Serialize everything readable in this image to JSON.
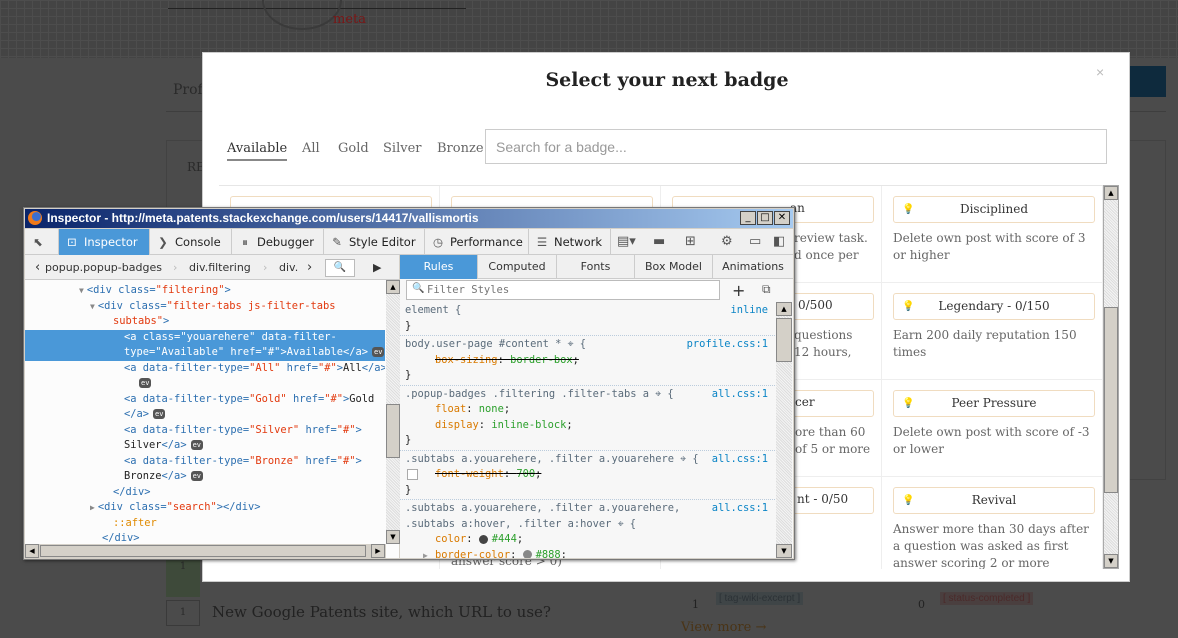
{
  "background": {
    "site_logo_text": "meta",
    "profile_tab": "Profi",
    "section_label": "RE",
    "questions": [
      {
        "votes": "1",
        "title": ""
      },
      {
        "votes": "1",
        "title": "New Google Patents site, which URL to use?"
      }
    ],
    "tags": [
      {
        "count": "1",
        "tag": "[ tag-wiki-excerpt ]"
      },
      {
        "count": "0",
        "tag": "[ status-completed ]"
      }
    ],
    "view_more": "View more →"
  },
  "modal": {
    "title": "Select your next badge",
    "close_label": "×",
    "filter_tabs": [
      "Available",
      "All",
      "Gold",
      "Silver",
      "Bronze"
    ],
    "active_tab": "Available",
    "search_placeholder": "Search for a badge...",
    "partial_texts": {
      "r1c3_title": "an",
      "r1c3_desc": [
        "review task.",
        "d once per"
      ],
      "r2c3_title": "0/500",
      "r2c3_desc": [
        "questions",
        "12 hours,"
      ],
      "r3c3_title": "cer",
      "r3c3_desc": [
        "ore than 60",
        "of 5 or more"
      ],
      "r4c3_title": "nt - 0/50",
      "r4c2_desc": "answer score > 0)"
    },
    "badges_col4": [
      {
        "name": "Disciplined",
        "tier": "bronze",
        "description": "Delete own post with score of 3 or higher"
      },
      {
        "name": "Legendary - 0/150",
        "tier": "gold",
        "description": "Earn 200 daily reputation 150 times"
      },
      {
        "name": "Peer Pressure",
        "tier": "bronze",
        "description": "Delete own post with score of -3 or lower"
      },
      {
        "name": "Revival",
        "tier": "bronze",
        "description": "Answer more than 30 days after a question was asked as first answer scoring 2 or more"
      }
    ]
  },
  "devtools": {
    "window_title": "Inspector - http://meta.patents.stackexchange.com/users/14417/vallismortis",
    "tools": [
      {
        "label": "Inspector",
        "icon": "inspector-icon",
        "active": true
      },
      {
        "label": "Console",
        "icon": "console-icon"
      },
      {
        "label": "Debugger",
        "icon": "debugger-icon"
      },
      {
        "label": "Style Editor",
        "icon": "style-editor-icon"
      },
      {
        "label": "Performance",
        "icon": "performance-icon"
      },
      {
        "label": "Network",
        "icon": "network-icon"
      }
    ],
    "breadcrumbs": [
      "popup.popup-badges",
      "div.filtering",
      "div."
    ],
    "side_tabs": [
      "Rules",
      "Computed",
      "Fonts",
      "Box Model",
      "Animations"
    ],
    "active_side_tab": "Rules",
    "filter_placeholder": "Filter Styles",
    "markup_lines": [
      {
        "indent": 6,
        "twisty": "▼",
        "tokens": [
          [
            "tag",
            "<div "
          ],
          [
            "attr",
            "class="
          ],
          [
            "val",
            "\"filtering\""
          ],
          [
            "tag",
            ">"
          ]
        ]
      },
      {
        "indent": 7,
        "twisty": "▼",
        "tokens": [
          [
            "tag",
            "<div "
          ],
          [
            "attr",
            "class="
          ],
          [
            "val",
            "\"filter-tabs js-filter-tabs"
          ]
        ]
      },
      {
        "indent": 8,
        "tokens": [
          [
            "val",
            "subtabs\""
          ],
          [
            "tag",
            ">"
          ]
        ]
      },
      {
        "indent": 9,
        "selected": true,
        "tokens": [
          [
            "tag",
            "<a "
          ],
          [
            "attr",
            "class="
          ],
          [
            "val",
            "\"youarehere\""
          ],
          [
            "attr",
            " data-filter-"
          ]
        ]
      },
      {
        "indent": 9,
        "selected": true,
        "tokens": [
          [
            "attr",
            "type="
          ],
          [
            "val",
            "\"Available\""
          ],
          [
            "attr",
            " href="
          ],
          [
            "val",
            "\"#\""
          ],
          [
            "tag",
            ">"
          ],
          [
            "txt",
            "Available"
          ],
          [
            "tag",
            "</a>"
          ]
        ],
        "ev": true
      },
      {
        "indent": 9,
        "tokens": [
          [
            "tag",
            "<a "
          ],
          [
            "attr",
            "data-filter-type="
          ],
          [
            "val",
            "\"All\""
          ],
          [
            "attr",
            " href="
          ],
          [
            "val",
            "\"#\""
          ],
          [
            "tag",
            ">"
          ],
          [
            "txt",
            "All"
          ],
          [
            "tag",
            "</a>"
          ]
        ]
      },
      {
        "indent": 10,
        "tokens": [],
        "ev": true
      },
      {
        "indent": 9,
        "tokens": [
          [
            "tag",
            "<a "
          ],
          [
            "attr",
            "data-filter-type="
          ],
          [
            "val",
            "\"Gold\""
          ],
          [
            "attr",
            " href="
          ],
          [
            "val",
            "\"#\""
          ],
          [
            "tag",
            ">"
          ],
          [
            "txt",
            "Gold"
          ]
        ]
      },
      {
        "indent": 9,
        "tokens": [
          [
            "tag",
            "</a>"
          ]
        ],
        "ev": true
      },
      {
        "indent": 9,
        "tokens": [
          [
            "tag",
            "<a "
          ],
          [
            "attr",
            "data-filter-type="
          ],
          [
            "val",
            "\"Silver\""
          ],
          [
            "attr",
            " href="
          ],
          [
            "val",
            "\"#\""
          ],
          [
            "tag",
            ">"
          ]
        ]
      },
      {
        "indent": 9,
        "tokens": [
          [
            "txt",
            "Silver"
          ],
          [
            "tag",
            "</a>"
          ]
        ],
        "ev": true
      },
      {
        "indent": 9,
        "tokens": [
          [
            "tag",
            "<a "
          ],
          [
            "attr",
            "data-filter-type="
          ],
          [
            "val",
            "\"Bronze\""
          ],
          [
            "attr",
            " href="
          ],
          [
            "val",
            "\"#\""
          ],
          [
            "tag",
            ">"
          ]
        ]
      },
      {
        "indent": 9,
        "tokens": [
          [
            "txt",
            "Bronze"
          ],
          [
            "tag",
            "</a>"
          ]
        ],
        "ev": true
      },
      {
        "indent": 8,
        "tokens": [
          [
            "tag",
            "</div>"
          ]
        ]
      },
      {
        "indent": 7,
        "twisty": "▶",
        "tokens": [
          [
            "tag",
            "<div "
          ],
          [
            "attr",
            "class="
          ],
          [
            "val",
            "\"search\""
          ],
          [
            "tag",
            "></div>"
          ]
        ]
      },
      {
        "indent": 8,
        "tokens": [
          [
            "pse",
            "::after"
          ]
        ]
      },
      {
        "indent": 7,
        "tokens": [
          [
            "tag",
            "</div>"
          ]
        ]
      }
    ],
    "rules": [
      {
        "selector": "element {",
        "source": "inline",
        "decls": [],
        "close": "}"
      },
      {
        "selector": "body.user-page #content * ⌖ {",
        "source": "profile.css:1",
        "decls": [
          {
            "prop": "box-sizing",
            "value": "border-box",
            "overridden": true
          }
        ],
        "close": "}"
      },
      {
        "selector": ".popup-badges .filtering .filter-tabs a ⌖ {",
        "source": "all.css:1",
        "decls": [
          {
            "prop": "float",
            "value": "none"
          },
          {
            "prop": "display",
            "value": "inline-block"
          }
        ],
        "close": "}"
      },
      {
        "selector": ".subtabs a.youarehere, .filter a.youarehere ⌖ {",
        "source": "all.css:1",
        "decls": [
          {
            "prop": "font-weight",
            "value": "700",
            "overridden": true,
            "checkbox": true
          }
        ],
        "close": "}"
      },
      {
        "selector": ".subtabs a.youarehere, .filter a.youarehere,\n.subtabs a:hover, .filter a:hover ⌖ {",
        "source": "all.css:1",
        "decls": [
          {
            "prop": "color",
            "value": "#444",
            "swatch": "#444444"
          },
          {
            "prop": "border-color",
            "value": "#888",
            "swatch": "#888888",
            "expandable": true
          }
        ],
        "close": "}"
      }
    ]
  },
  "colors": {
    "devtools_accent": "#4a98d8",
    "bronze": "#c99a6a",
    "gold": "#e8c23a"
  }
}
